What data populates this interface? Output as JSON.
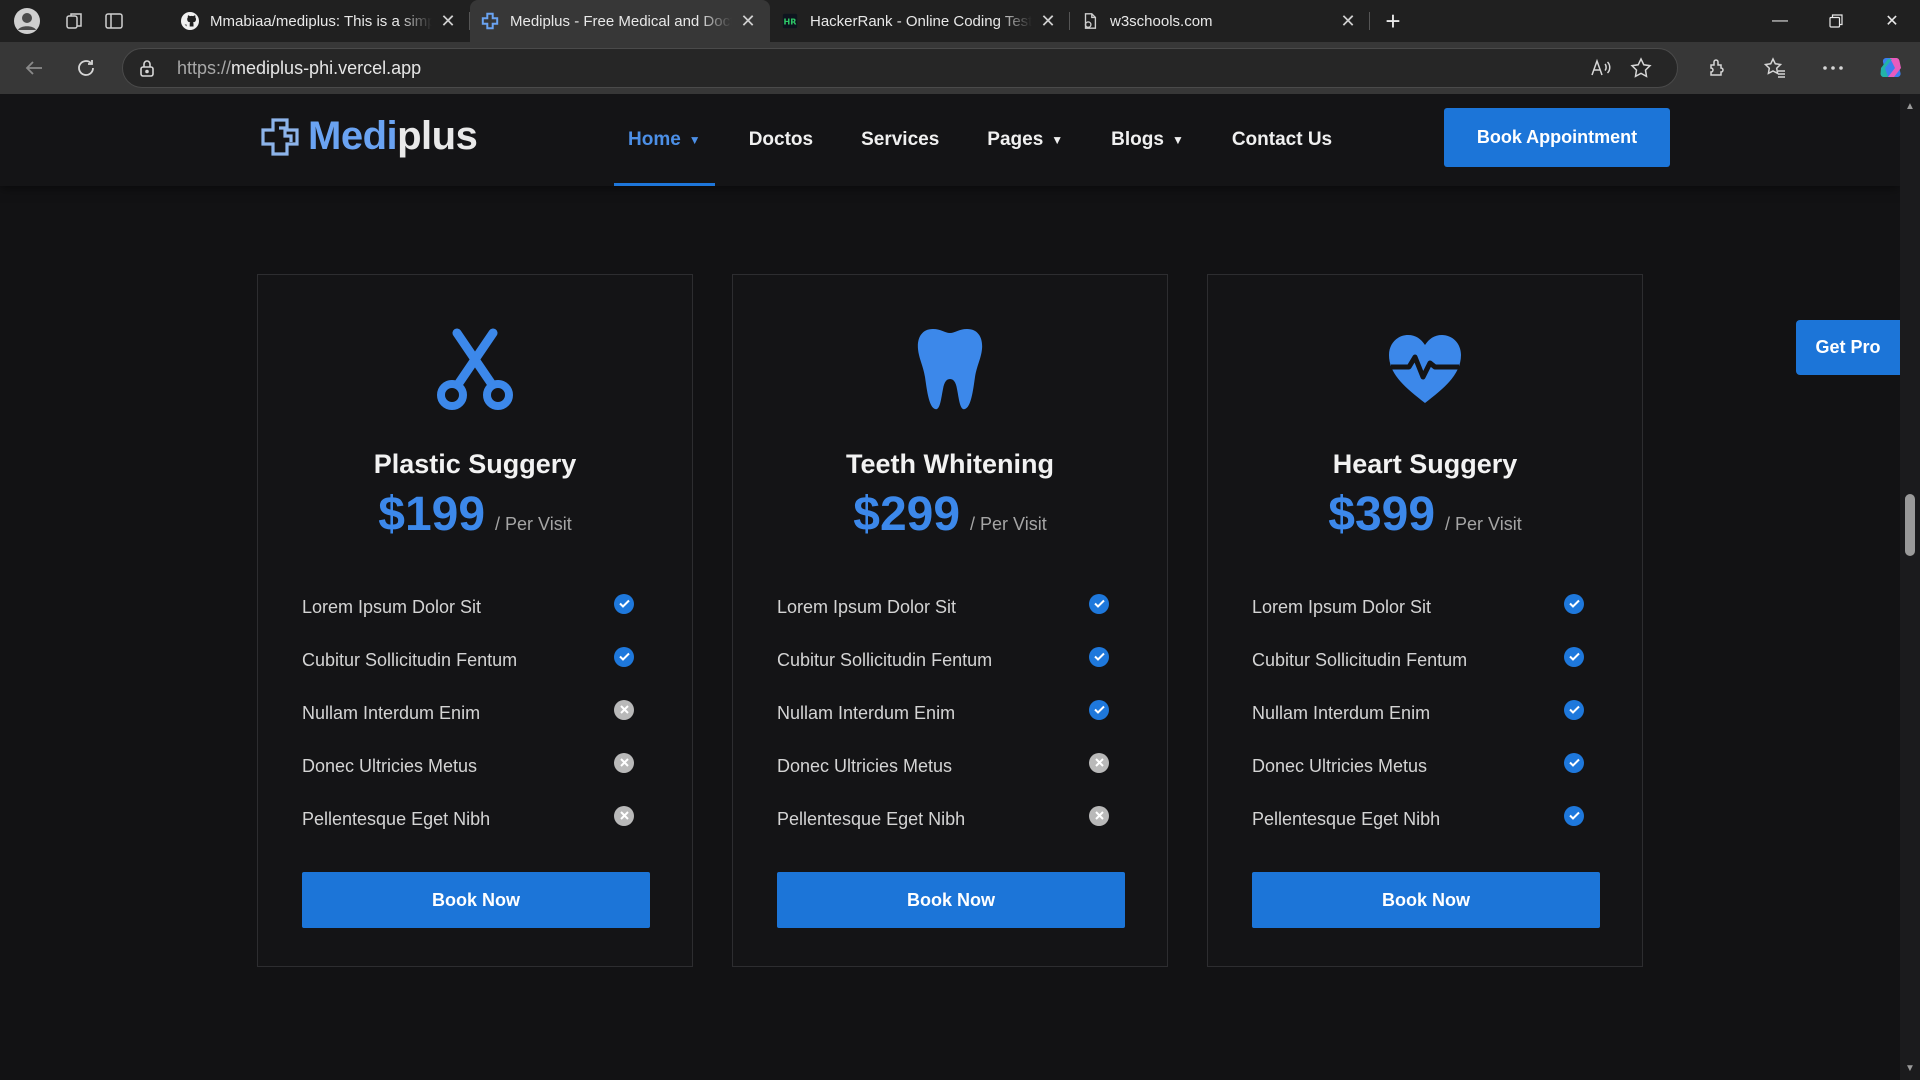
{
  "browser": {
    "tabs": [
      {
        "title": "Mmabiaa/mediplus: This is a simple",
        "active": false,
        "favicon": "github-icon"
      },
      {
        "title": "Mediplus - Free Medical and Doctor",
        "active": true,
        "favicon": "mediplus-icon"
      },
      {
        "title": "HackerRank - Online Coding Tests",
        "active": false,
        "favicon": "hackerrank-icon"
      },
      {
        "title": "w3schools.com",
        "active": false,
        "favicon": "page-icon"
      }
    ],
    "url_protocol": "https://",
    "url_host": "mediplus-phi.vercel.app"
  },
  "site": {
    "logo_part1": "Medi",
    "logo_part2": "plus",
    "nav": [
      {
        "label": "Home",
        "dropdown": true,
        "active": true
      },
      {
        "label": "Doctos",
        "dropdown": false,
        "active": false
      },
      {
        "label": "Services",
        "dropdown": false,
        "active": false
      },
      {
        "label": "Pages",
        "dropdown": true,
        "active": false
      },
      {
        "label": "Blogs",
        "dropdown": true,
        "active": false
      },
      {
        "label": "Contact Us",
        "dropdown": false,
        "active": false
      }
    ],
    "book_appointment": "Book Appointment",
    "get_pro": "Get Pro",
    "accent_color": "#1c75d8"
  },
  "pricing": [
    {
      "icon": "scissors-icon",
      "title": "Plastic Suggery",
      "price": "$199",
      "per": "/ Per Visit",
      "features": [
        {
          "label": "Lorem Ipsum Dolor Sit",
          "included": true
        },
        {
          "label": "Cubitur Sollicitudin Fentum",
          "included": true
        },
        {
          "label": "Nullam Interdum Enim",
          "included": false
        },
        {
          "label": "Donec Ultricies Metus",
          "included": false
        },
        {
          "label": "Pellentesque Eget Nibh",
          "included": false
        }
      ],
      "button": "Book Now"
    },
    {
      "icon": "tooth-icon",
      "title": "Teeth Whitening",
      "price": "$299",
      "per": "/ Per Visit",
      "features": [
        {
          "label": "Lorem Ipsum Dolor Sit",
          "included": true
        },
        {
          "label": "Cubitur Sollicitudin Fentum",
          "included": true
        },
        {
          "label": "Nullam Interdum Enim",
          "included": true
        },
        {
          "label": "Donec Ultricies Metus",
          "included": false
        },
        {
          "label": "Pellentesque Eget Nibh",
          "included": false
        }
      ],
      "button": "Book Now"
    },
    {
      "icon": "heartbeat-icon",
      "title": "Heart Suggery",
      "price": "$399",
      "per": "/ Per Visit",
      "features": [
        {
          "label": "Lorem Ipsum Dolor Sit",
          "included": true
        },
        {
          "label": "Cubitur Sollicitudin Fentum",
          "included": true
        },
        {
          "label": "Nullam Interdum Enim",
          "included": true
        },
        {
          "label": "Donec Ultricies Metus",
          "included": true
        },
        {
          "label": "Pellentesque Eget Nibh",
          "included": true
        }
      ],
      "button": "Book Now"
    }
  ]
}
